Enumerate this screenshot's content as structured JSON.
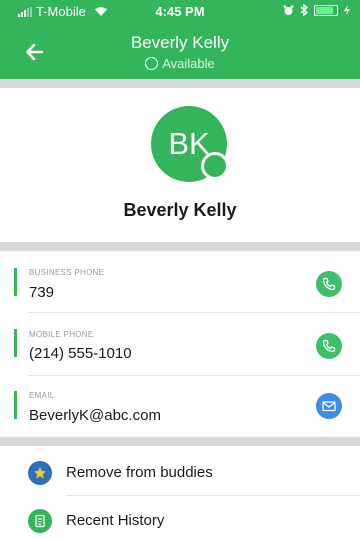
{
  "status_bar": {
    "carrier": "T-Mobile",
    "time": "4:45 PM"
  },
  "header": {
    "title": "Beverly Kelly",
    "presence_status": "Available",
    "color": "#34b55b"
  },
  "profile": {
    "initials": "BK",
    "name": "Beverly Kelly",
    "presence": "available"
  },
  "contact": {
    "business_phone": {
      "label": "BUSINESS PHONE",
      "value": "739",
      "icon": "phone-icon"
    },
    "mobile_phone": {
      "label": "MOBILE PHONE",
      "value": "(214) 555-1010",
      "icon": "phone-icon"
    },
    "email": {
      "label": "EMAIL",
      "value": "BeverlyK@abc.com",
      "icon": "mail-icon"
    }
  },
  "actions": {
    "remove_buddy": "Remove from buddies",
    "recent_history": "Recent History"
  },
  "colors": {
    "accent": "#34b55b",
    "email_action": "#3b8ee3",
    "star_icon_bg": "#2f6fb5",
    "divider": "#d8d8d8"
  }
}
